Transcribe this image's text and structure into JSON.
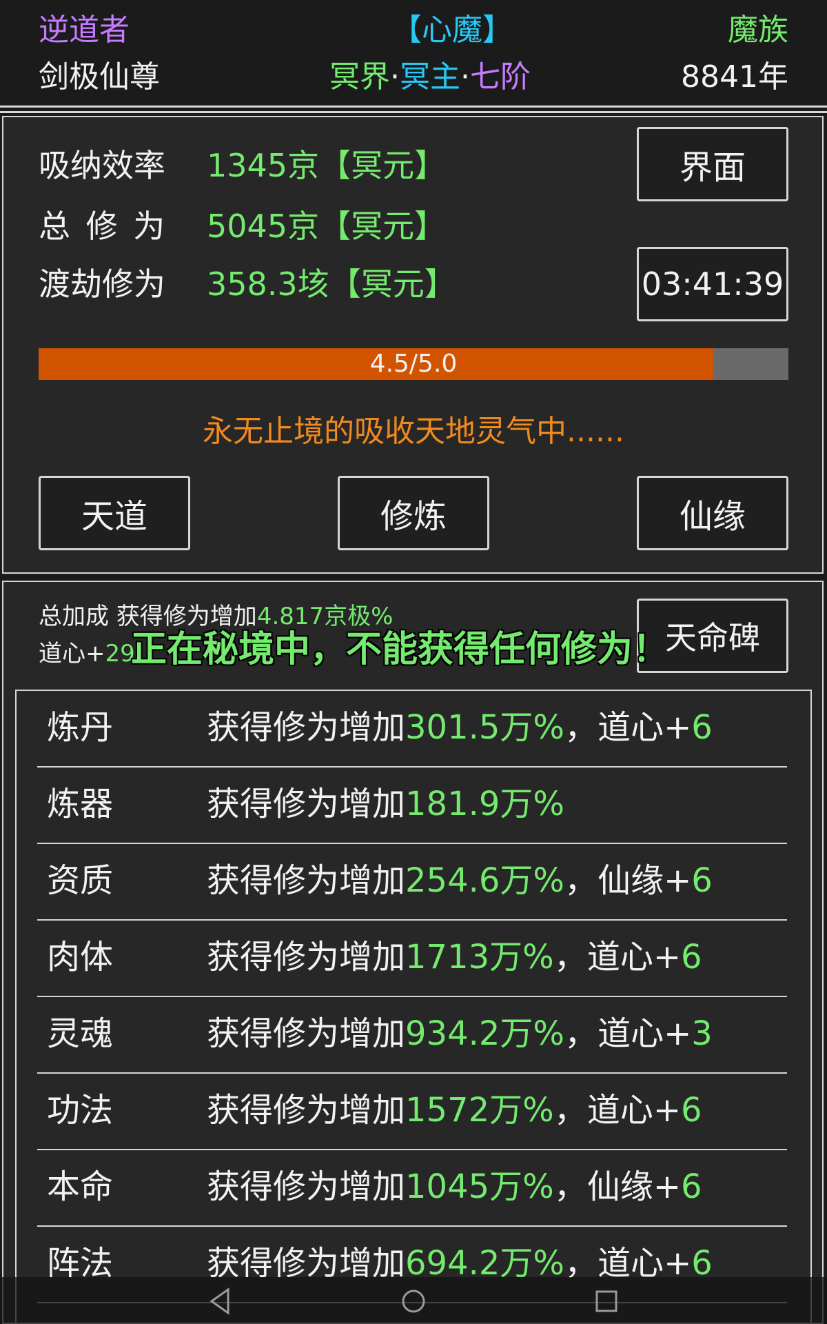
{
  "header": {
    "left_title": "逆道者",
    "left_sub": "剑极仙尊",
    "center_title": "【心魔】",
    "center_sub_1": "冥界",
    "dot": "·",
    "center_sub_2": "冥主",
    "center_sub_3": "七阶",
    "right_title": "魔族",
    "right_sub": "8841年"
  },
  "stats": [
    {
      "label": "吸纳效率",
      "value": "1345京【冥元】"
    },
    {
      "label": "总 修 为",
      "value": "5045京【冥元】"
    },
    {
      "label": "渡劫修为",
      "value": "358.3垓【冥元】"
    }
  ],
  "buttons": {
    "interface": "界面",
    "timer": "03:41:39",
    "tiandao": "天道",
    "xiulian": "修炼",
    "xianyuan": "仙缘",
    "tianmingbei": "天命碑"
  },
  "progress": {
    "text": "4.5/5.0",
    "value": 4.5,
    "max": 5.0
  },
  "status_message": "永无止境的吸收天地灵气中......",
  "bonus": {
    "line1_label": "总加成 获得修为增加",
    "line1_value": "4.817京极%",
    "line2_label": "道心+",
    "line2_value": "29"
  },
  "overlay_message": "正在秘境中，不能获得任何修为！",
  "list": [
    {
      "name": "炼丹",
      "prefix": "获得修为增加",
      "value": "301.5万%",
      "suffix_sep": "，",
      "suffix_label": "道心+",
      "suffix_value": "6"
    },
    {
      "name": "炼器",
      "prefix": "获得修为增加",
      "value": "181.9万%",
      "suffix_sep": "",
      "suffix_label": "",
      "suffix_value": ""
    },
    {
      "name": "资质",
      "prefix": "获得修为增加",
      "value": "254.6万%",
      "suffix_sep": "，",
      "suffix_label": "仙缘+",
      "suffix_value": "6"
    },
    {
      "name": "肉体",
      "prefix": "获得修为增加",
      "value": "1713万%",
      "suffix_sep": "，",
      "suffix_label": "道心+",
      "suffix_value": "6"
    },
    {
      "name": "灵魂",
      "prefix": "获得修为增加",
      "value": "934.2万%",
      "suffix_sep": "，",
      "suffix_label": "道心+",
      "suffix_value": "3"
    },
    {
      "name": "功法",
      "prefix": "获得修为增加",
      "value": "1572万%",
      "suffix_sep": "，",
      "suffix_label": "道心+",
      "suffix_value": "6"
    },
    {
      "name": "本命",
      "prefix": "获得修为增加",
      "value": "1045万%",
      "suffix_sep": "，",
      "suffix_label": "仙缘+",
      "suffix_value": "6"
    },
    {
      "name": "阵法",
      "prefix": "获得修为增加",
      "value": "694.2万%",
      "suffix_sep": "，",
      "suffix_label": "道心+",
      "suffix_value": "6"
    }
  ],
  "navbar": {
    "icons": [
      "back-icon",
      "home-icon",
      "recents-icon"
    ]
  },
  "colors": {
    "green": "#74ea6e",
    "purple": "#c57cff",
    "cyan": "#28c8f5",
    "orange": "#f08a1e",
    "progress_fill": "#d35400"
  }
}
